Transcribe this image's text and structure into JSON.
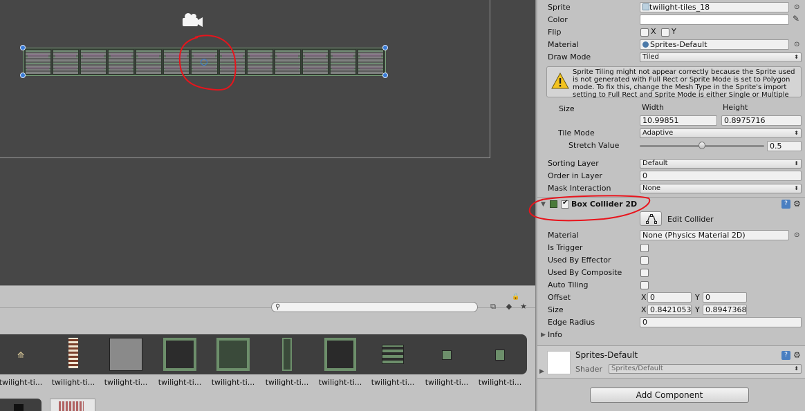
{
  "inspector": {
    "sprite_label": "Sprite",
    "sprite_value": "twilight-tiles_18",
    "color_label": "Color",
    "flip_label": "Flip",
    "flip_x": "X",
    "flip_y": "Y",
    "material_label": "Material",
    "material_value": "Sprites-Default",
    "draw_mode_label": "Draw Mode",
    "draw_mode_value": "Tiled",
    "warning_text": "Sprite Tiling might not appear correctly because the Sprite used is not generated with Full Rect or Sprite Mode is set to Polygon mode. To fix this, change the Mesh Type in the Sprite's import setting to Full Rect and Sprite Mode is either Single or Multiple",
    "size_label": "Size",
    "width_label": "Width",
    "height_label": "Height",
    "width_value": "10.99851",
    "height_value": "0.8975716",
    "tile_mode_label": "Tile Mode",
    "tile_mode_value": "Adaptive",
    "stretch_label": "Stretch Value",
    "stretch_value": "0.5",
    "stretch_level": 0.5,
    "sorting_layer_label": "Sorting Layer",
    "sorting_layer_value": "Default",
    "order_label": "Order in Layer",
    "order_value": "0",
    "mask_label": "Mask Interaction",
    "mask_value": "None",
    "box_collider": {
      "title": "Box Collider 2D",
      "edit_collider": "Edit Collider",
      "material_label": "Material",
      "material_value": "None (Physics Material 2D)",
      "is_trigger": "Is Trigger",
      "used_by_effector": "Used By Effector",
      "used_by_composite": "Used By Composite",
      "auto_tiling": "Auto Tiling",
      "offset_label": "Offset",
      "offset_x": "0",
      "offset_y": "0",
      "size_label": "Size",
      "size_x": "0.8421053",
      "size_y": "0.8947368",
      "edge_radius_label": "Edge Radius",
      "edge_radius_value": "0",
      "info_label": "Info",
      "x_axis": "X",
      "y_axis": "Y"
    },
    "material_block": {
      "name": "Sprites-Default",
      "shader_label": "Shader",
      "shader_value": "Sprites/Default"
    },
    "add_component": "Add Component"
  },
  "project": {
    "search_placeholder": "",
    "assets": [
      "twilight-ti...",
      "twilight-ti...",
      "twilight-ti...",
      "twilight-ti...",
      "twilight-ti...",
      "twilight-ti...",
      "twilight-ti...",
      "twilight-ti...",
      "twilight-ti...",
      "twilight-ti..."
    ]
  },
  "colors": {
    "scene_bg": "#474747",
    "selection_handle": "#3a7bd5",
    "annotation_red": "#e8141c",
    "panel_bg": "#c2c2c2"
  },
  "icons": [
    "camera-icon",
    "search-icon",
    "lock-icon",
    "warning-icon",
    "help-icon",
    "settings-gear-icon",
    "object-picker-icon",
    "eyedropper-icon",
    "edit-collider-icon",
    "star-icon",
    "label-icon",
    "filter-icon"
  ]
}
